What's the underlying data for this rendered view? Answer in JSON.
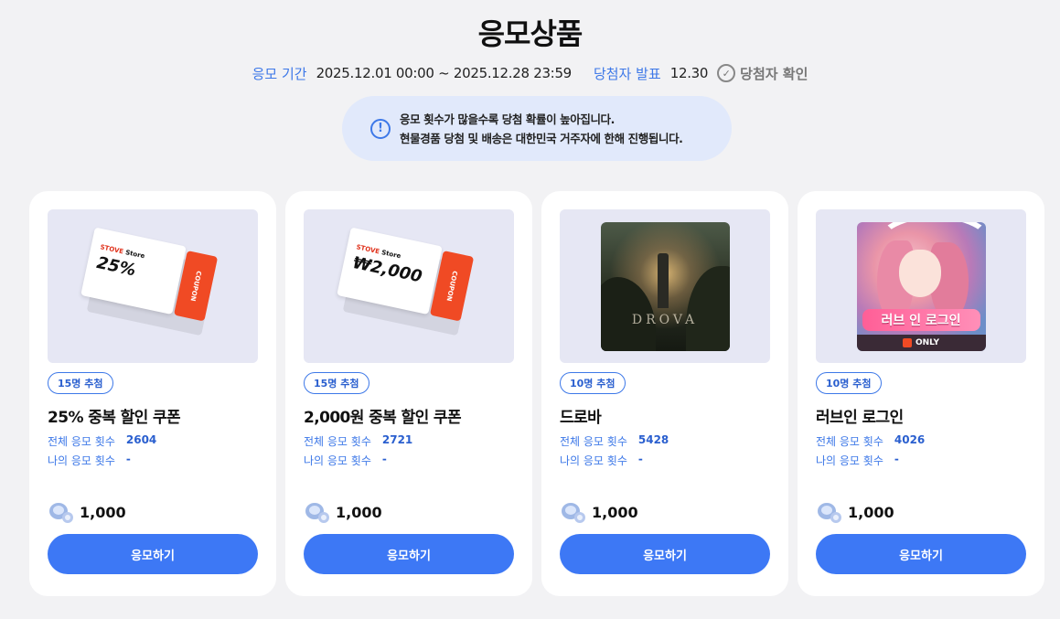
{
  "page": {
    "title": "응모상품"
  },
  "period": {
    "entry_label": "응모 기간",
    "entry_value": "2025.12.01 00:00 ~ 2025.12.28 23:59",
    "announce_label": "당첨자 발표",
    "announce_value": "12.30",
    "winner_check_label": "당첨자 확인"
  },
  "notice": {
    "line1": "응모 횟수가 많을수록 당첨 확률이 높아집니다.",
    "line2": "현물경품 당첨 및 배송은 대한민국 거주자에 한해 진행됩니다."
  },
  "cards": [
    {
      "badge": "15명 추첨",
      "title": "25% 중복 할인 쿠폰",
      "total_label": "전체 응모 횟수",
      "total_value": "2604",
      "mine_label": "나의 응모 횟수",
      "mine_value": "-",
      "price": "1,000",
      "button": "응모하기",
      "image": {
        "type": "coupon",
        "brand1": "STOVE",
        "brand2": "Store",
        "amount": "25%",
        "tab": "COUPON"
      }
    },
    {
      "badge": "15명 추첨",
      "title": "2,000원 중복 할인 쿠폰",
      "total_label": "전체 응모 횟수",
      "total_value": "2721",
      "mine_label": "나의 응모 횟수",
      "mine_value": "-",
      "price": "1,000",
      "button": "응모하기",
      "image": {
        "type": "coupon",
        "brand1": "STOVE",
        "brand2": "Store",
        "amount": "₩2,000",
        "tab": "COUPON"
      }
    },
    {
      "badge": "10명 추첨",
      "title": "드로바",
      "total_label": "전체 응모 횟수",
      "total_value": "5428",
      "mine_label": "나의 응모 횟수",
      "mine_value": "-",
      "price": "1,000",
      "button": "응모하기",
      "image": {
        "type": "game",
        "logo": "DROVA"
      }
    },
    {
      "badge": "10명 추첨",
      "title": "러브인 로그인",
      "total_label": "전체 응모 횟수",
      "total_value": "4026",
      "mine_label": "나의 응모 횟수",
      "mine_value": "-",
      "price": "1,000",
      "button": "응모하기",
      "image": {
        "type": "game",
        "logo": "러브 인 로그인",
        "only": "ONLY"
      }
    }
  ],
  "colors": {
    "accent": "#3d78f5",
    "label_blue": "#3d78e8",
    "notice_bg": "#e1e9fb",
    "coupon_red": "#f04a24"
  }
}
